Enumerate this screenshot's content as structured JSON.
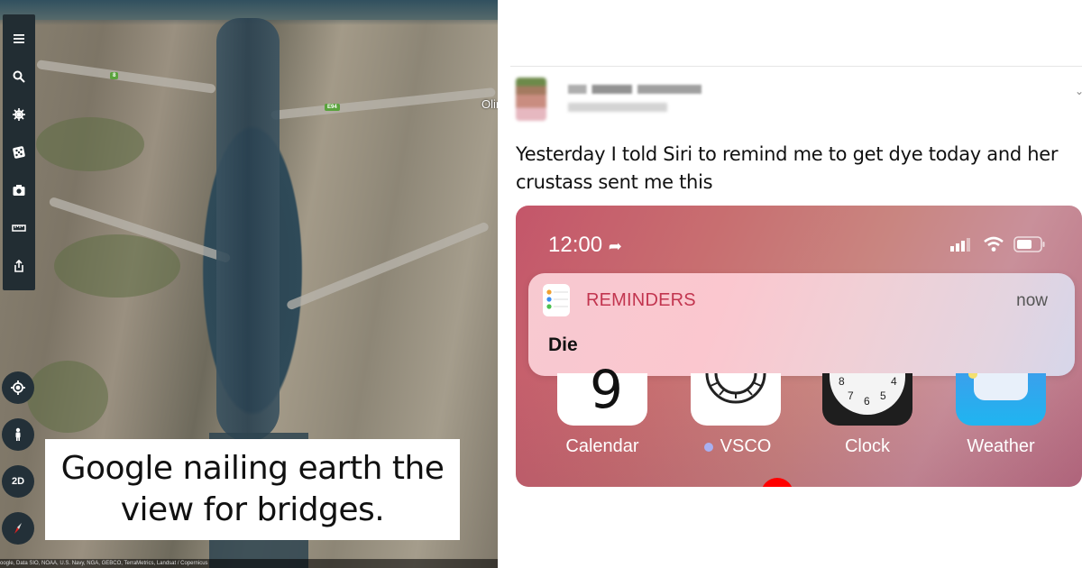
{
  "map_panel": {
    "toolbar": [
      {
        "icon": "menu-icon",
        "label": "Menu"
      },
      {
        "icon": "search-icon",
        "label": "Search"
      },
      {
        "icon": "voyager-wheel-icon",
        "label": "Voyager"
      },
      {
        "icon": "dice-icon",
        "label": "I'm Feeling Lucky"
      },
      {
        "icon": "camera-icon",
        "label": "Projects"
      },
      {
        "icon": "ruler-icon",
        "label": "Measure"
      },
      {
        "icon": "share-icon",
        "label": "Share"
      }
    ],
    "nav_controls": {
      "my_location": "my-location-icon",
      "pegman": "pegman-icon",
      "view_toggle_label": "2D",
      "compass": "compass-icon"
    },
    "road_badges": [
      "8",
      "E94"
    ],
    "place_label": "Olin",
    "attribution": "oogle, Data SIO, NOAA, U.S. Navy, NGA, GEBCO, TerraMetrics, Landsat / Copernicus",
    "caption": "Google nailing earth the view for bridges."
  },
  "tweet": {
    "author_name": "[blurred]",
    "author_handle": "[blurred]",
    "text": "Yesterday I told Siri to remind me to get dye today and her crustass sent me this",
    "menu_icon": "chevron-down-icon",
    "phone": {
      "status_time": "12:00",
      "status_icons": [
        "location-arrow-icon",
        "signal-icon",
        "wifi-icon",
        "battery-icon"
      ],
      "notification": {
        "app": "REMINDERS",
        "time": "now",
        "body": "Die"
      },
      "apps": [
        {
          "label": "Calendar",
          "icon": "calendar-icon",
          "badge_dot": false,
          "preview": "9"
        },
        {
          "label": "VSCO",
          "icon": "vsco-icon",
          "badge_dot": true
        },
        {
          "label": "Clock",
          "icon": "clock-icon",
          "badge_dot": false,
          "preview_numbers": [
            "8",
            "7",
            "6",
            "5",
            "4"
          ]
        },
        {
          "label": "Weather",
          "icon": "weather-icon",
          "badge_dot": false
        }
      ],
      "colors": {
        "badge_dot": "#a8b0f0",
        "reminders_accent": "#c2354f"
      }
    }
  }
}
